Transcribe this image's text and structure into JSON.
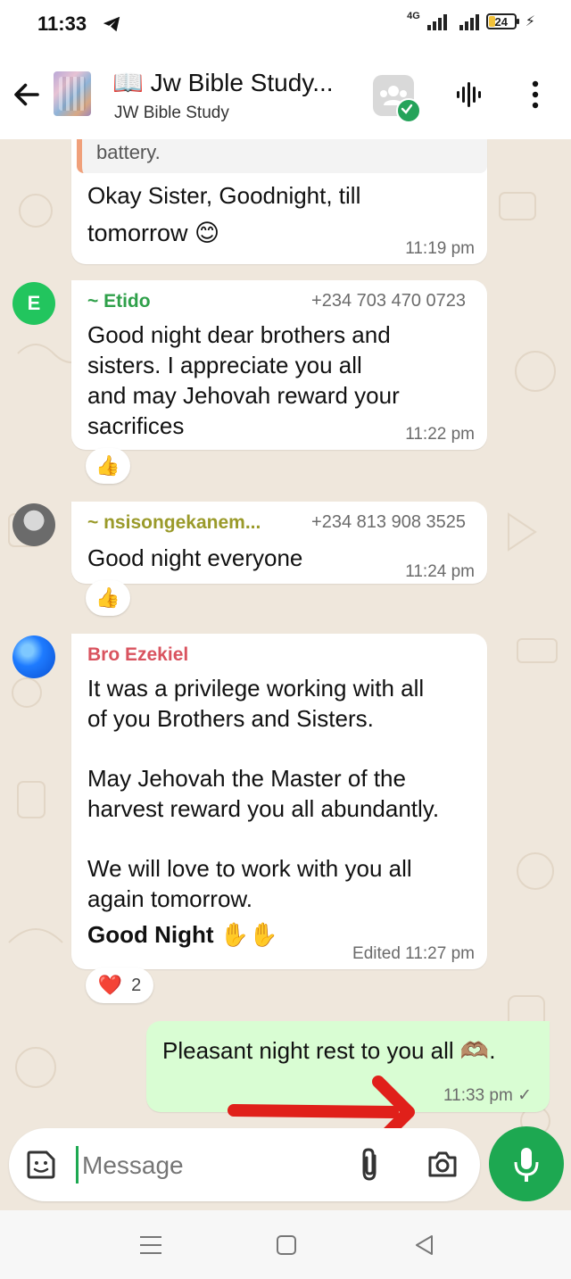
{
  "status_bar": {
    "time": "11:33",
    "network": "4G",
    "battery": "24"
  },
  "header": {
    "title": "📖 Jw Bible Study...",
    "subtitle": "JW Bible Study"
  },
  "messages": [
    {
      "quote": "battery.",
      "text_line1": "Okay Sister, Goodnight, till",
      "text_line2": "tomorrow 😊",
      "time": "11:19 pm"
    },
    {
      "avatar_letter": "E",
      "sender": "~ Etido",
      "phone": "+234 703 470 0723",
      "line1": "Good night dear brothers and",
      "line2": "sisters. I appreciate you all",
      "line3": "and may Jehovah reward your",
      "line4": "sacrifices",
      "time": "11:22 pm",
      "reaction": "👍"
    },
    {
      "sender": "~ nsisongekanem...",
      "phone": "+234 813 908 3525",
      "text": "Good night everyone",
      "time": "11:24 pm",
      "reaction": "👍"
    },
    {
      "sender": "Bro Ezekiel",
      "line1": "It was a privilege working with all",
      "line2": "of you Brothers and Sisters.",
      "line3": "May Jehovah the Master of the",
      "line4": "harvest reward you all abundantly.",
      "line5": "We will love to work with you all",
      "line6": "again tomorrow.",
      "bold_line": "Good Night ✋✋",
      "time": "Edited 11:27 pm",
      "reaction": "❤️",
      "reaction_count": "2"
    },
    {
      "text": "Pleasant night rest to you all 🫶🏽.",
      "time": "11:33 pm ✓"
    }
  ],
  "input": {
    "placeholder": "Message"
  },
  "colors": {
    "accent_green": "#1da851",
    "outgoing_bubble": "#d9fdd3",
    "sender_etido": "#2fa04a",
    "sender_nsisong": "#9a9a2a",
    "sender_ezekiel": "#d9535f",
    "annotation_arrow": "#e0201a"
  }
}
